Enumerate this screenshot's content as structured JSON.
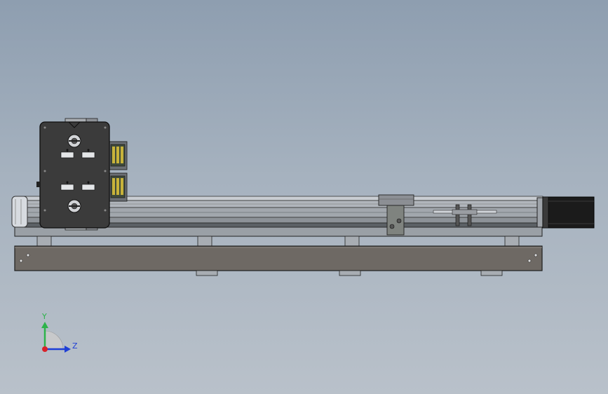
{
  "triad": {
    "y_label": "Y",
    "z_label": "Z",
    "y_color": "#2db34a",
    "z_color": "#1f3fd6",
    "x_color": "#d8222a"
  },
  "colors": {
    "plate": "#3b3b3b",
    "rail": "#a9aeb5",
    "base": "#6e6964",
    "motor": "#1b1b1b",
    "steel": "#8c8f94"
  }
}
